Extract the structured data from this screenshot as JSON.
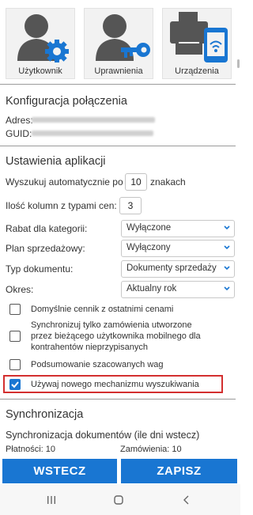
{
  "tiles": [
    {
      "label": "Użytkownik",
      "icon": "user-gear-icon"
    },
    {
      "label": "Uprawnienia",
      "icon": "user-key-icon"
    },
    {
      "label": "Urządzenia",
      "icon": "printer-phone-icon"
    }
  ],
  "connection": {
    "heading": "Konfiguracja połączenia",
    "address_label": "Adres:",
    "guid_label": "GUID:"
  },
  "app_settings": {
    "heading": "Ustawienia aplikacji",
    "auto_search_prefix": "Wyszukuj automatycznie po",
    "auto_search_value": "10",
    "auto_search_suffix": "znakach",
    "price_columns_label": "Ilość kolumn z typami cen:",
    "price_columns_value": "3",
    "category_discount_label": "Rabat dla kategorii:",
    "category_discount_value": "Wyłączone",
    "sales_plan_label": "Plan sprzedażowy:",
    "sales_plan_value": "Wyłączony",
    "doc_type_label": "Typ dokumentu:",
    "doc_type_value": "Dokumenty sprzedaży",
    "period_label": "Okres:",
    "period_value": "Aktualny rok"
  },
  "checkboxes": [
    {
      "label": "Domyślnie cennik z ostatnimi cenami",
      "checked": false
    },
    {
      "label_lines": [
        "Synchronizuj tylko zamówienia utworzone",
        "przez bieżącego użytkownika mobilnego dla",
        "kontrahentów nieprzypisanych"
      ],
      "checked": false
    },
    {
      "label": "Podsumowanie szacowanych wag",
      "checked": false
    },
    {
      "label": "Używaj nowego mechanizmu wyszukiwania",
      "checked": true
    }
  ],
  "sync": {
    "heading": "Synchronizacja",
    "docs_label": "Synchronizacja dokumentów (ile dni wstecz)",
    "payments_label": "Płatności: 10",
    "orders_label": "Zamówienia: 10"
  },
  "buttons": {
    "back": "WSTECZ",
    "save": "ZAPISZ"
  },
  "colors": {
    "accent": "#1976d2",
    "highlight": "#d32f2f"
  }
}
